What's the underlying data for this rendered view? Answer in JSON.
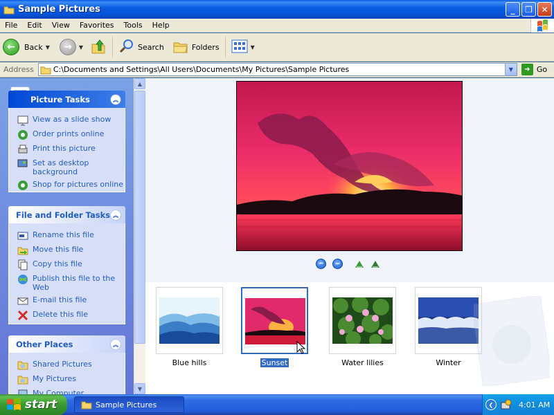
{
  "window": {
    "title": "Sample Pictures"
  },
  "menu": [
    "File",
    "Edit",
    "View",
    "Favorites",
    "Tools",
    "Help"
  ],
  "toolbar": {
    "back": "Back",
    "search": "Search",
    "folders": "Folders"
  },
  "address": {
    "label": "Address",
    "path": "C:\\Documents and Settings\\All Users\\Documents\\My Pictures\\Sample Pictures",
    "go": "Go"
  },
  "taskpane": {
    "picture_tasks": {
      "title": "Picture Tasks",
      "items": [
        {
          "label": "View as a slide show",
          "icon": "slideshow-icon"
        },
        {
          "label": "Order prints online",
          "icon": "web-order-icon"
        },
        {
          "label": "Print this picture",
          "icon": "printer-icon"
        },
        {
          "label": "Set as desktop background",
          "icon": "desktop-icon"
        },
        {
          "label": "Shop for pictures online",
          "icon": "shop-icon"
        }
      ]
    },
    "file_tasks": {
      "title": "File and Folder Tasks",
      "items": [
        {
          "label": "Rename this file",
          "icon": "rename-icon"
        },
        {
          "label": "Move this file",
          "icon": "move-icon"
        },
        {
          "label": "Copy this file",
          "icon": "copy-icon"
        },
        {
          "label": "Publish this file to the Web",
          "icon": "publish-icon"
        },
        {
          "label": "E-mail this file",
          "icon": "email-icon"
        },
        {
          "label": "Delete this file",
          "icon": "delete-icon"
        }
      ]
    },
    "other_places": {
      "title": "Other Places",
      "items": [
        {
          "label": "Shared Pictures",
          "icon": "folder-icon"
        },
        {
          "label": "My Pictures",
          "icon": "folder-icon"
        },
        {
          "label": "My Computer",
          "icon": "computer-icon"
        }
      ]
    }
  },
  "thumbnails": [
    {
      "label": "Blue hills",
      "selected": false
    },
    {
      "label": "Sunset",
      "selected": true
    },
    {
      "label": "Water lilies",
      "selected": false
    },
    {
      "label": "Winter",
      "selected": false
    }
  ],
  "taskbar": {
    "start": "start",
    "window_button": "Sample Pictures",
    "clock": "4:01 AM"
  },
  "colors": {
    "accent": "#316ac5",
    "task_link": "#215dc6",
    "taskbar": "#245ddb"
  }
}
